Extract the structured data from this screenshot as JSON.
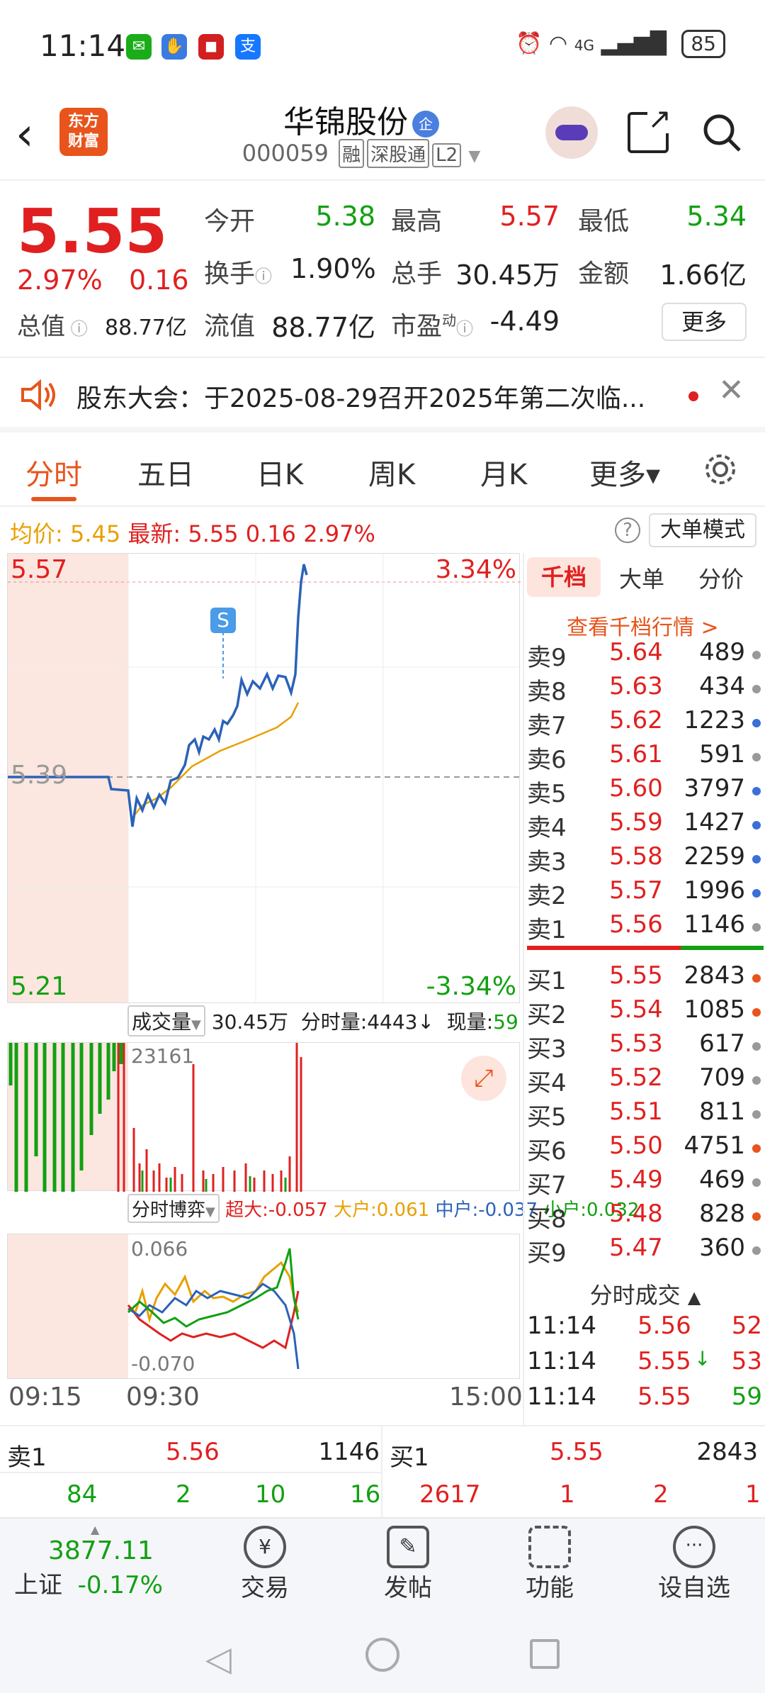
{
  "status": {
    "time": "11:14",
    "network": "4G",
    "battery": "85"
  },
  "header": {
    "logo": "东方财富",
    "title": "华锦股份",
    "title_badge": "企",
    "code": "000059",
    "tags": [
      "融",
      "深股通",
      "L2"
    ]
  },
  "quote": {
    "price": "5.55",
    "pct": "2.97%",
    "change": "0.16",
    "market_value_label": "总值",
    "market_value": "88.77亿",
    "open_label": "今开",
    "open": "5.38",
    "high_label": "最高",
    "high": "5.57",
    "low_label": "最低",
    "low": "5.34",
    "turnover_label": "换手",
    "turnover": "1.90%",
    "volume_label": "总手",
    "volume": "30.45万",
    "amount_label": "金额",
    "amount": "1.66亿",
    "float_label": "流值",
    "float_value": "88.77亿",
    "pe_label": "市盈",
    "pe_sup": "动",
    "pe": "-4.49",
    "more": "更多"
  },
  "notice": {
    "text": "股东大会：于2025-08-29召开2025年第二次临..."
  },
  "tabs": [
    "分时",
    "五日",
    "日K",
    "周K",
    "月K",
    "更多▾"
  ],
  "avg_row": {
    "avg_label": "均价:",
    "avg": "5.45",
    "latest_label": "最新:",
    "latest": "5.55",
    "change": "0.16",
    "pct": "2.97%",
    "help": "?",
    "mode": "大单模式"
  },
  "chart": {
    "y_top": "5.57",
    "y_mid": "5.39",
    "y_bottom": "5.21",
    "pct_top": "3.34%",
    "pct_bottom": "-3.34%",
    "marker": "S"
  },
  "volume_bar": {
    "selector": "成交量",
    "total": "30.45万",
    "period_label": "分时量:",
    "period": "4443",
    "now_label": "现量:",
    "now": "59",
    "max": "23161"
  },
  "flow": {
    "selector": "分时博弈",
    "super": "超大:-0.057",
    "large": "大户:0.061",
    "mid": "中户:-0.037",
    "small": "小户:0.032",
    "top": "0.066",
    "bottom": "-0.070"
  },
  "time_axis": [
    "09:15",
    "09:30",
    "15:00"
  ],
  "book": {
    "tabs": [
      "千档",
      "大单",
      "分价"
    ],
    "link": "查看千档行情 >",
    "sells": [
      {
        "l": "卖9",
        "p": "5.64",
        "v": "489",
        "c": "#999"
      },
      {
        "l": "卖8",
        "p": "5.63",
        "v": "434",
        "c": "#999"
      },
      {
        "l": "卖7",
        "p": "5.62",
        "v": "1223",
        "c": "#3a6fd8"
      },
      {
        "l": "卖6",
        "p": "5.61",
        "v": "591",
        "c": "#999"
      },
      {
        "l": "卖5",
        "p": "5.60",
        "v": "3797",
        "c": "#3a6fd8"
      },
      {
        "l": "卖4",
        "p": "5.59",
        "v": "1427",
        "c": "#3a6fd8"
      },
      {
        "l": "卖3",
        "p": "5.58",
        "v": "2259",
        "c": "#3a6fd8"
      },
      {
        "l": "卖2",
        "p": "5.57",
        "v": "1996",
        "c": "#3a6fd8"
      },
      {
        "l": "卖1",
        "p": "5.56",
        "v": "1146",
        "c": "#999"
      }
    ],
    "buys": [
      {
        "l": "买1",
        "p": "5.55",
        "v": "2843",
        "c": "#e8541c"
      },
      {
        "l": "买2",
        "p": "5.54",
        "v": "1085",
        "c": "#e8541c"
      },
      {
        "l": "买3",
        "p": "5.53",
        "v": "617",
        "c": "#999"
      },
      {
        "l": "买4",
        "p": "5.52",
        "v": "709",
        "c": "#999"
      },
      {
        "l": "买5",
        "p": "5.51",
        "v": "811",
        "c": "#999"
      },
      {
        "l": "买6",
        "p": "5.50",
        "v": "4751",
        "c": "#e8541c"
      },
      {
        "l": "买7",
        "p": "5.49",
        "v": "469",
        "c": "#999"
      },
      {
        "l": "买8",
        "p": "5.48",
        "v": "828",
        "c": "#e8541c"
      },
      {
        "l": "买9",
        "p": "5.47",
        "v": "360",
        "c": "#999"
      }
    ],
    "ticks_title": "分时成交",
    "ticks": [
      {
        "t": "11:14",
        "p": "5.56",
        "v": "52",
        "a": ""
      },
      {
        "t": "11:14",
        "p": "5.55",
        "v": "53",
        "a": "↓"
      },
      {
        "t": "11:14",
        "p": "5.55",
        "v": "59",
        "a": ""
      }
    ]
  },
  "bottom": {
    "sell_label": "卖1",
    "sell_price": "5.56",
    "sell_vol": "1146",
    "sell_q": [
      "84",
      "2",
      "10",
      "16"
    ],
    "buy_label": "买1",
    "buy_price": "5.55",
    "buy_vol": "2843",
    "buy_q": [
      "2617",
      "1",
      "2",
      "1"
    ]
  },
  "nav": {
    "index_value": "3877.11",
    "index_name": "上证",
    "index_pct": "-0.17%",
    "items": [
      "交易",
      "发帖",
      "功能",
      "设自选"
    ]
  }
}
